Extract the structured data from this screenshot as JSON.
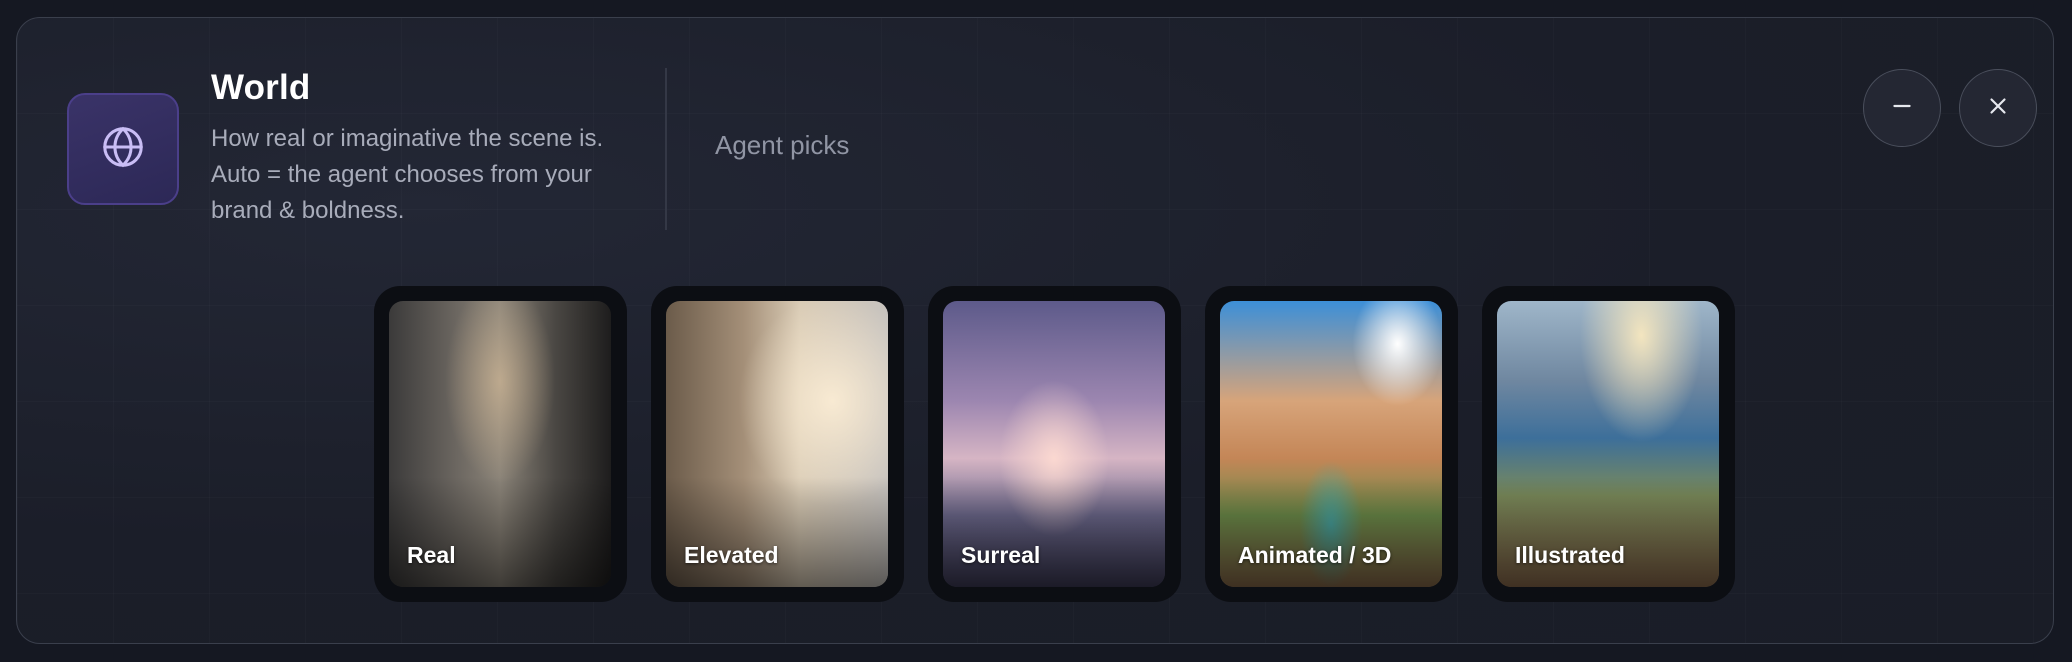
{
  "header": {
    "icon": "globe-icon",
    "title": "World",
    "description": "How real or imaginative the scene is. Auto = the agent chooses from your brand & boldness.",
    "agent_label": "Agent picks"
  },
  "controls": {
    "minimize_icon": "minus-icon",
    "close_icon": "close-icon"
  },
  "cards": [
    {
      "label": "Real"
    },
    {
      "label": "Elevated"
    },
    {
      "label": "Surreal"
    },
    {
      "label": "Animated / 3D"
    },
    {
      "label": "Illustrated"
    }
  ],
  "colors": {
    "background": "#151822",
    "panel": "#1b1e29",
    "accent": "#3a3368",
    "accent_icon": "#c9bdf5"
  }
}
